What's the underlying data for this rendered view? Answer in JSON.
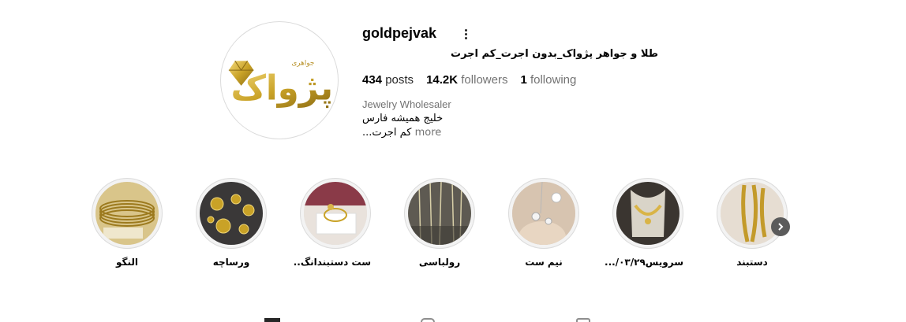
{
  "profile": {
    "username": "goldpejvak",
    "full_name": "طلا و جواهر پژواک_بدون اجرت_کم اجرت",
    "stats": {
      "posts_count": "434",
      "posts_label": "posts",
      "followers_count": "14.2K",
      "followers_label": "followers",
      "following_count": "1",
      "following_label": "following"
    },
    "category": "Jewelry Wholesaler",
    "bio_line1": "خلیج همیشه فارس",
    "bio_line2": "کم اجرت...",
    "more_label": "more",
    "avatar_logo_small": "جواهری",
    "avatar_logo_main": "پژواک"
  },
  "highlights": [
    {
      "label": "النگو"
    },
    {
      "label": "ورساچه"
    },
    {
      "label": "ست دستبندانگ.."
    },
    {
      "label": "رولباسی"
    },
    {
      "label": "نیم ست"
    },
    {
      "label": "سرویس۰۳/۲۹/..."
    },
    {
      "label": "دستبند"
    }
  ],
  "colors": {
    "gold": "#c9a227",
    "text": "#262626",
    "muted": "#737373",
    "border": "#dbdbdb"
  },
  "icons": {
    "options": "more-options-icon",
    "next": "chevron-right-icon",
    "tabs": [
      "grid-icon",
      "reels-icon",
      "tagged-icon"
    ]
  }
}
